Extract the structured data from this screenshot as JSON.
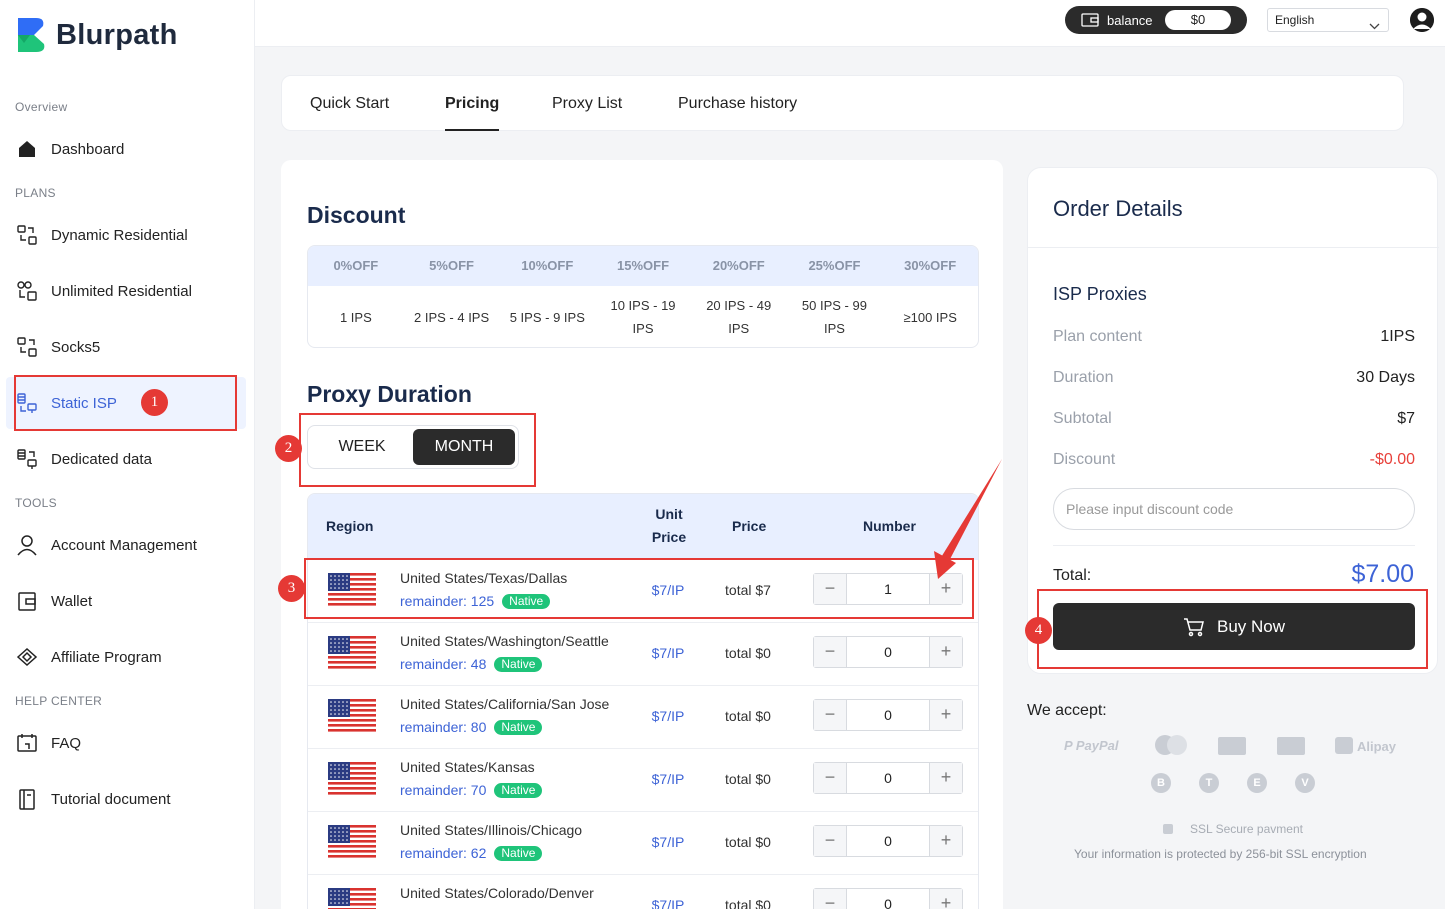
{
  "app": {
    "brand": "Blurpath"
  },
  "topbar": {
    "balance_label": "balance",
    "balance_value": "$0",
    "language": "English"
  },
  "sidebar": {
    "sections": {
      "overview": "Overview",
      "plans": "PLANS",
      "tools": "TOOLS",
      "help": "HELP CENTER"
    },
    "items": [
      {
        "label": "Dashboard",
        "icon": "home-icon"
      },
      {
        "label": "Dynamic Residential",
        "icon": "residential-icon"
      },
      {
        "label": "Unlimited Residential",
        "icon": "unlimited-icon"
      },
      {
        "label": "Socks5",
        "icon": "socks-icon"
      },
      {
        "label": "Static ISP",
        "icon": "isp-icon",
        "active": true
      },
      {
        "label": "Dedicated data",
        "icon": "dedicated-icon"
      },
      {
        "label": "Account Management",
        "icon": "user-icon"
      },
      {
        "label": "Wallet",
        "icon": "wallet-icon"
      },
      {
        "label": "Affiliate Program",
        "icon": "affiliate-icon"
      },
      {
        "label": "FAQ",
        "icon": "faq-icon"
      },
      {
        "label": "Tutorial document",
        "icon": "document-icon"
      }
    ]
  },
  "tabs": [
    "Quick Start",
    "Pricing",
    "Proxy List",
    "Purchase history"
  ],
  "discount": {
    "title": "Discount",
    "headers": [
      "0%OFF",
      "5%OFF",
      "10%OFF",
      "15%OFF",
      "20%OFF",
      "25%OFF",
      "30%OFF"
    ],
    "ranges": [
      "1 IPS",
      "2 IPS - 4 IPS",
      "5 IPS - 9 IPS",
      "10 IPS - 19 IPS",
      "20 IPS - 49 IPS",
      "50 IPS - 99 IPS",
      "≥100 IPS"
    ]
  },
  "duration": {
    "title": "Proxy Duration",
    "week": "WEEK",
    "month": "MONTH",
    "selected": "MONTH"
  },
  "region_table": {
    "headers": {
      "region": "Region",
      "unit_price": "Unit Price",
      "price": "Price",
      "number": "Number"
    },
    "native_label": "Native",
    "rows": [
      {
        "name": "United States/Texas/Dallas",
        "remainder": "remainder: 125",
        "unit": "$7/IP",
        "total": "total $7",
        "qty": "1"
      },
      {
        "name": "United States/Washington/Seattle",
        "remainder": "remainder: 48",
        "unit": "$7/IP",
        "total": "total $0",
        "qty": "0"
      },
      {
        "name": "United States/California/San Jose",
        "remainder": "remainder: 80",
        "unit": "$7/IP",
        "total": "total $0",
        "qty": "0"
      },
      {
        "name": "United States/Kansas",
        "remainder": "remainder: 70",
        "unit": "$7/IP",
        "total": "total $0",
        "qty": "0"
      },
      {
        "name": "United States/Illinois/Chicago",
        "remainder": "remainder: 62",
        "unit": "$7/IP",
        "total": "total $0",
        "qty": "0"
      },
      {
        "name": "United States/Colorado/Denver",
        "remainder": "",
        "unit": "$7/IP",
        "total": "total $0",
        "qty": "0"
      }
    ]
  },
  "order": {
    "title": "Order Details",
    "product": "ISP Proxies",
    "plan_content_label": "Plan content",
    "plan_content": "1IPS",
    "duration_label": "Duration",
    "duration": "30 Days",
    "subtotal_label": "Subtotal",
    "subtotal": "$7",
    "discount_label": "Discount",
    "discount": "-$0.00",
    "discount_placeholder": "Please input discount code",
    "total_label": "Total:",
    "total": "$7.00",
    "buy_label": "Buy Now"
  },
  "payments": {
    "accept_label": "We accept:",
    "methods": [
      "PayPal",
      "Alipay"
    ],
    "coins": [
      "B",
      "T",
      "E",
      "V"
    ],
    "ssl_label": "SSL Secure pavment",
    "ssl_note": "Your information is protected by 256-bit SSL encryption"
  },
  "annotations": [
    "1",
    "2",
    "3",
    "4"
  ],
  "colors": {
    "accent": "#3d63d6",
    "dark": "#2b2b2b",
    "annotation": "#e53935",
    "native": "#1fc47a"
  }
}
